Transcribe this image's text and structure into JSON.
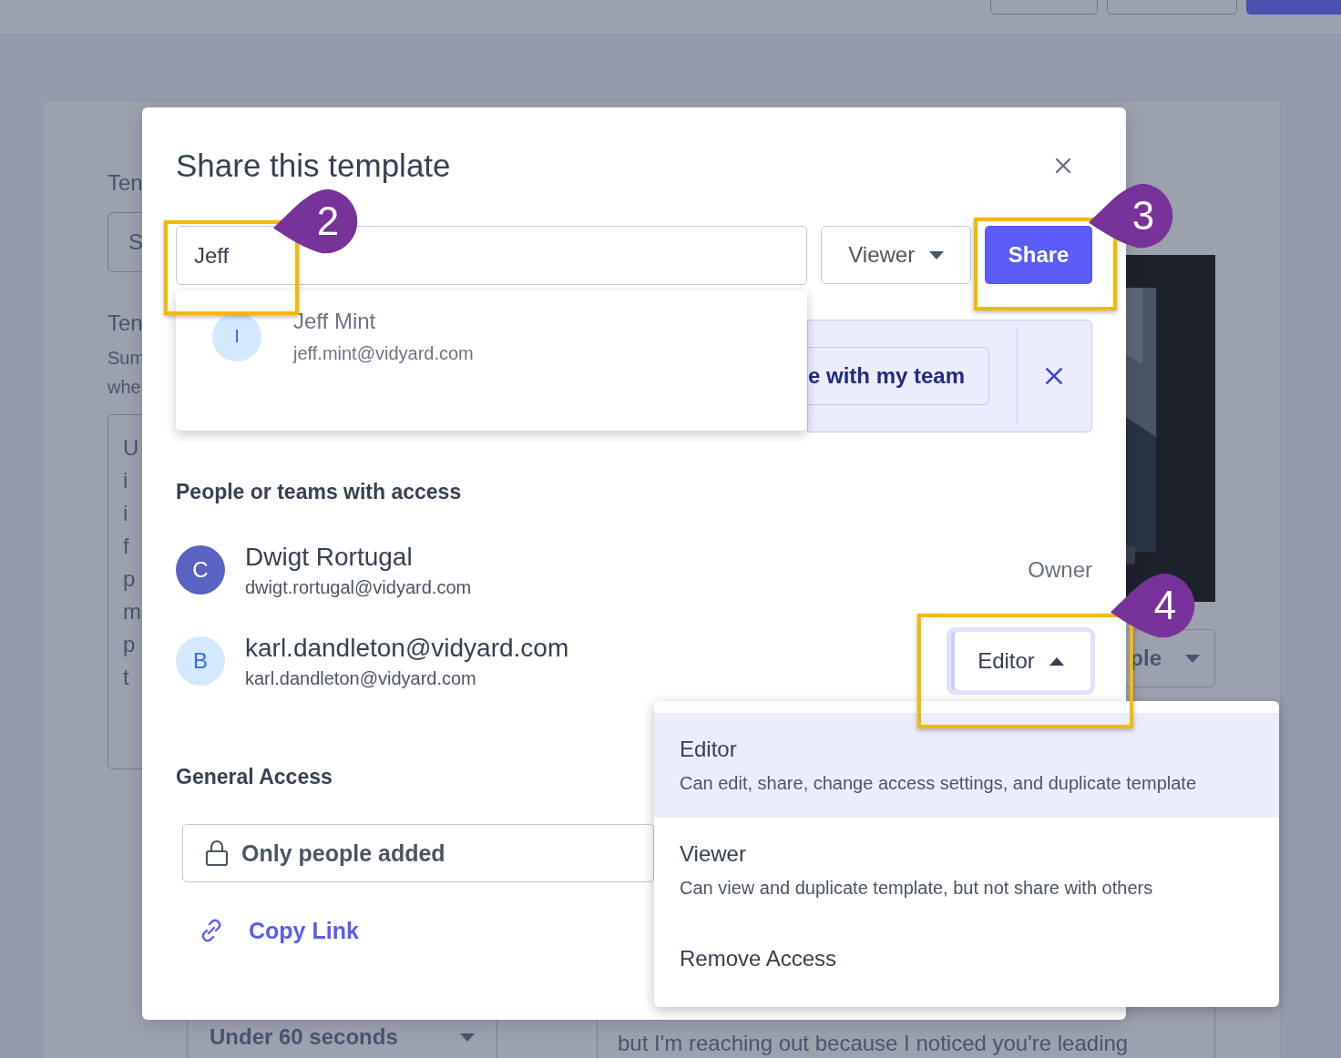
{
  "header_buttons": [
    {
      "kind": "outline"
    },
    {
      "kind": "outline"
    },
    {
      "kind": "primary"
    }
  ],
  "form": {
    "label_1": "Ten",
    "field_1": "S",
    "label_2": "Ten",
    "help_lines": [
      "Sum",
      "whe"
    ],
    "textarea_lines": [
      "U",
      "i",
      "i",
      "f",
      "p",
      "m",
      "p",
      "t"
    ],
    "duration_select": "Under 60 seconds",
    "style_select": "ple",
    "message_line": "but I'm reaching out because I noticed you're leading"
  },
  "modal": {
    "title": "Share this template",
    "invite": {
      "value": "Jeff",
      "role": "Viewer",
      "button": "Share"
    },
    "suggestions": [
      {
        "initial": "I",
        "name": "Jeff Mint",
        "email": "jeff.mint@vidyard.com",
        "color": "#d4e8ff"
      }
    ],
    "team_banner": {
      "button": "e with my team"
    },
    "access_heading": "People or teams with access",
    "members": [
      {
        "initial": "C",
        "name": "Dwigt Rortugal",
        "email": "dwigt.rortugal@vidyard.com",
        "color": "#5a62c2",
        "kind": "label",
        "role": "Owner"
      },
      {
        "initial": "B",
        "name": "karl.dandleton@vidyard.com",
        "email": "karl.dandleton@vidyard.com",
        "color": "#d4e8ff",
        "kind": "dropdown",
        "role": "Editor",
        "expanded": true
      }
    ],
    "general_heading": "General Access",
    "general_access": "Only people added",
    "copy_link": "Copy Link"
  },
  "role_menu": [
    {
      "title": "Editor",
      "description": "Can edit, share, change access settings, and duplicate template",
      "selected": true
    },
    {
      "title": "Viewer",
      "description": "Can view and duplicate template, but not share with others",
      "selected": false
    },
    {
      "title": "Remove Access",
      "selected": false
    }
  ],
  "callouts": [
    {
      "number": "2"
    },
    {
      "number": "3"
    },
    {
      "number": "4"
    }
  ]
}
